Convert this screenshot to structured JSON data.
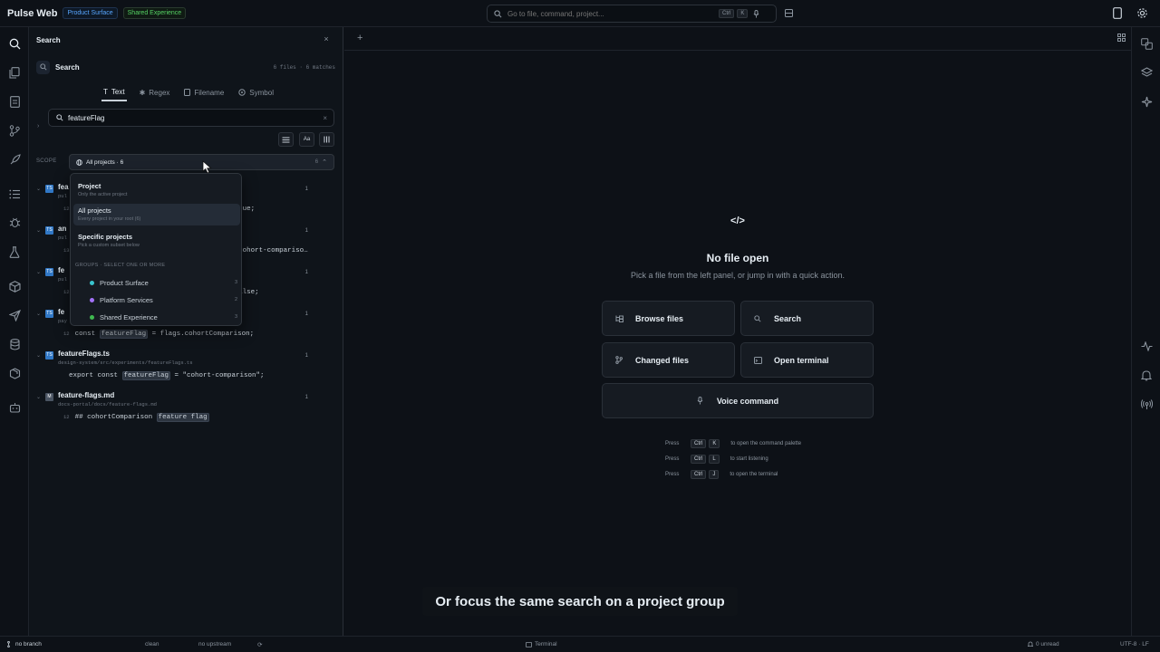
{
  "titlebar": {
    "app_title": "Pulse Web",
    "badges": [
      "Product Surface",
      "Shared Experience"
    ],
    "search_placeholder": "Go to file, command, project...",
    "search_keys": [
      "Ctrl",
      "K"
    ]
  },
  "side_panel": {
    "title": "Search",
    "close_label": "×",
    "search_header": "Search",
    "search_summary": "6 files · 6 matches",
    "tabs": [
      "Text",
      "Regex",
      "Filename",
      "Symbol"
    ],
    "query": "featureFlag",
    "option_labels": [
      "Aa"
    ],
    "scope_label": "SCOPE",
    "scope_value": "All projects · 6",
    "scope_count": "6"
  },
  "results": [
    {
      "name": "fea",
      "path": "pul",
      "count": "1",
      "lnum": "12",
      "pre": "",
      "match": "",
      "post": "true;"
    },
    {
      "name": "an",
      "path": "pul",
      "count": "1",
      "lnum": "13",
      "pre": "",
      "match": "",
      "post": "\"cohort-compariso…"
    },
    {
      "name": "fe",
      "path": "pul",
      "count": "1",
      "lnum": "12",
      "pre": "",
      "match": "",
      "post": "false;"
    },
    {
      "name": "fe",
      "path": "pay",
      "count": "1",
      "lnum": "12",
      "pre": "const ",
      "match": "featureFlag",
      "post": " = flags.cohortComparison;"
    },
    {
      "name": "featureFlags.ts",
      "path": "design-system/src/experiments/featureFlags.ts",
      "count": "1",
      "lnum": "",
      "pre": "export const ",
      "match": "featureFlag",
      "post": " = \"cohort-comparison\";"
    },
    {
      "name": "feature-flags.md",
      "path": "docs-portal/docs/feature-flags.md",
      "count": "1",
      "lnum": "12",
      "pre": "## cohortComparison ",
      "match": "feature flag",
      "post": ""
    }
  ],
  "scope_dropdown": {
    "options": [
      {
        "title": "Project",
        "subtitle": "Only the active project"
      },
      {
        "title": "All projects",
        "subtitle": "Every project in your root (6)"
      },
      {
        "title": "Specific projects",
        "subtitle": "Pick a custom subset below"
      }
    ],
    "groups_heading": "GROUPS · SELECT ONE OR MORE",
    "groups": [
      {
        "name": "Product Surface",
        "count": "3",
        "color": "#39c5cf"
      },
      {
        "name": "Platform Services",
        "count": "2",
        "color": "#a371f7"
      },
      {
        "name": "Shared Experience",
        "count": "3",
        "color": "#3fb950"
      }
    ]
  },
  "empty_state": {
    "icon": "</>",
    "title": "No file open",
    "subtitle": "Pick a file from the left panel, or jump in with a quick action.",
    "actions": [
      "Browse files",
      "Search",
      "Changed files",
      "Open terminal",
      "Voice command"
    ],
    "shortcuts": [
      {
        "press": "Press",
        "k1": "Ctrl",
        "k2": "K",
        "desc": "to open the command palette"
      },
      {
        "press": "Press",
        "k1": "Ctrl",
        "k2": "L",
        "desc": "to start listening"
      },
      {
        "press": "Press",
        "k1": "Ctrl",
        "k2": "J",
        "desc": "to open the terminal"
      }
    ]
  },
  "caption": "Or focus the same search on a project group",
  "statusbar": {
    "branch": "no branch",
    "state": "clean",
    "upstream": "no upstream",
    "terminal": "Terminal",
    "unread": "0 unread",
    "encoding": "UTF-8 · LF"
  }
}
